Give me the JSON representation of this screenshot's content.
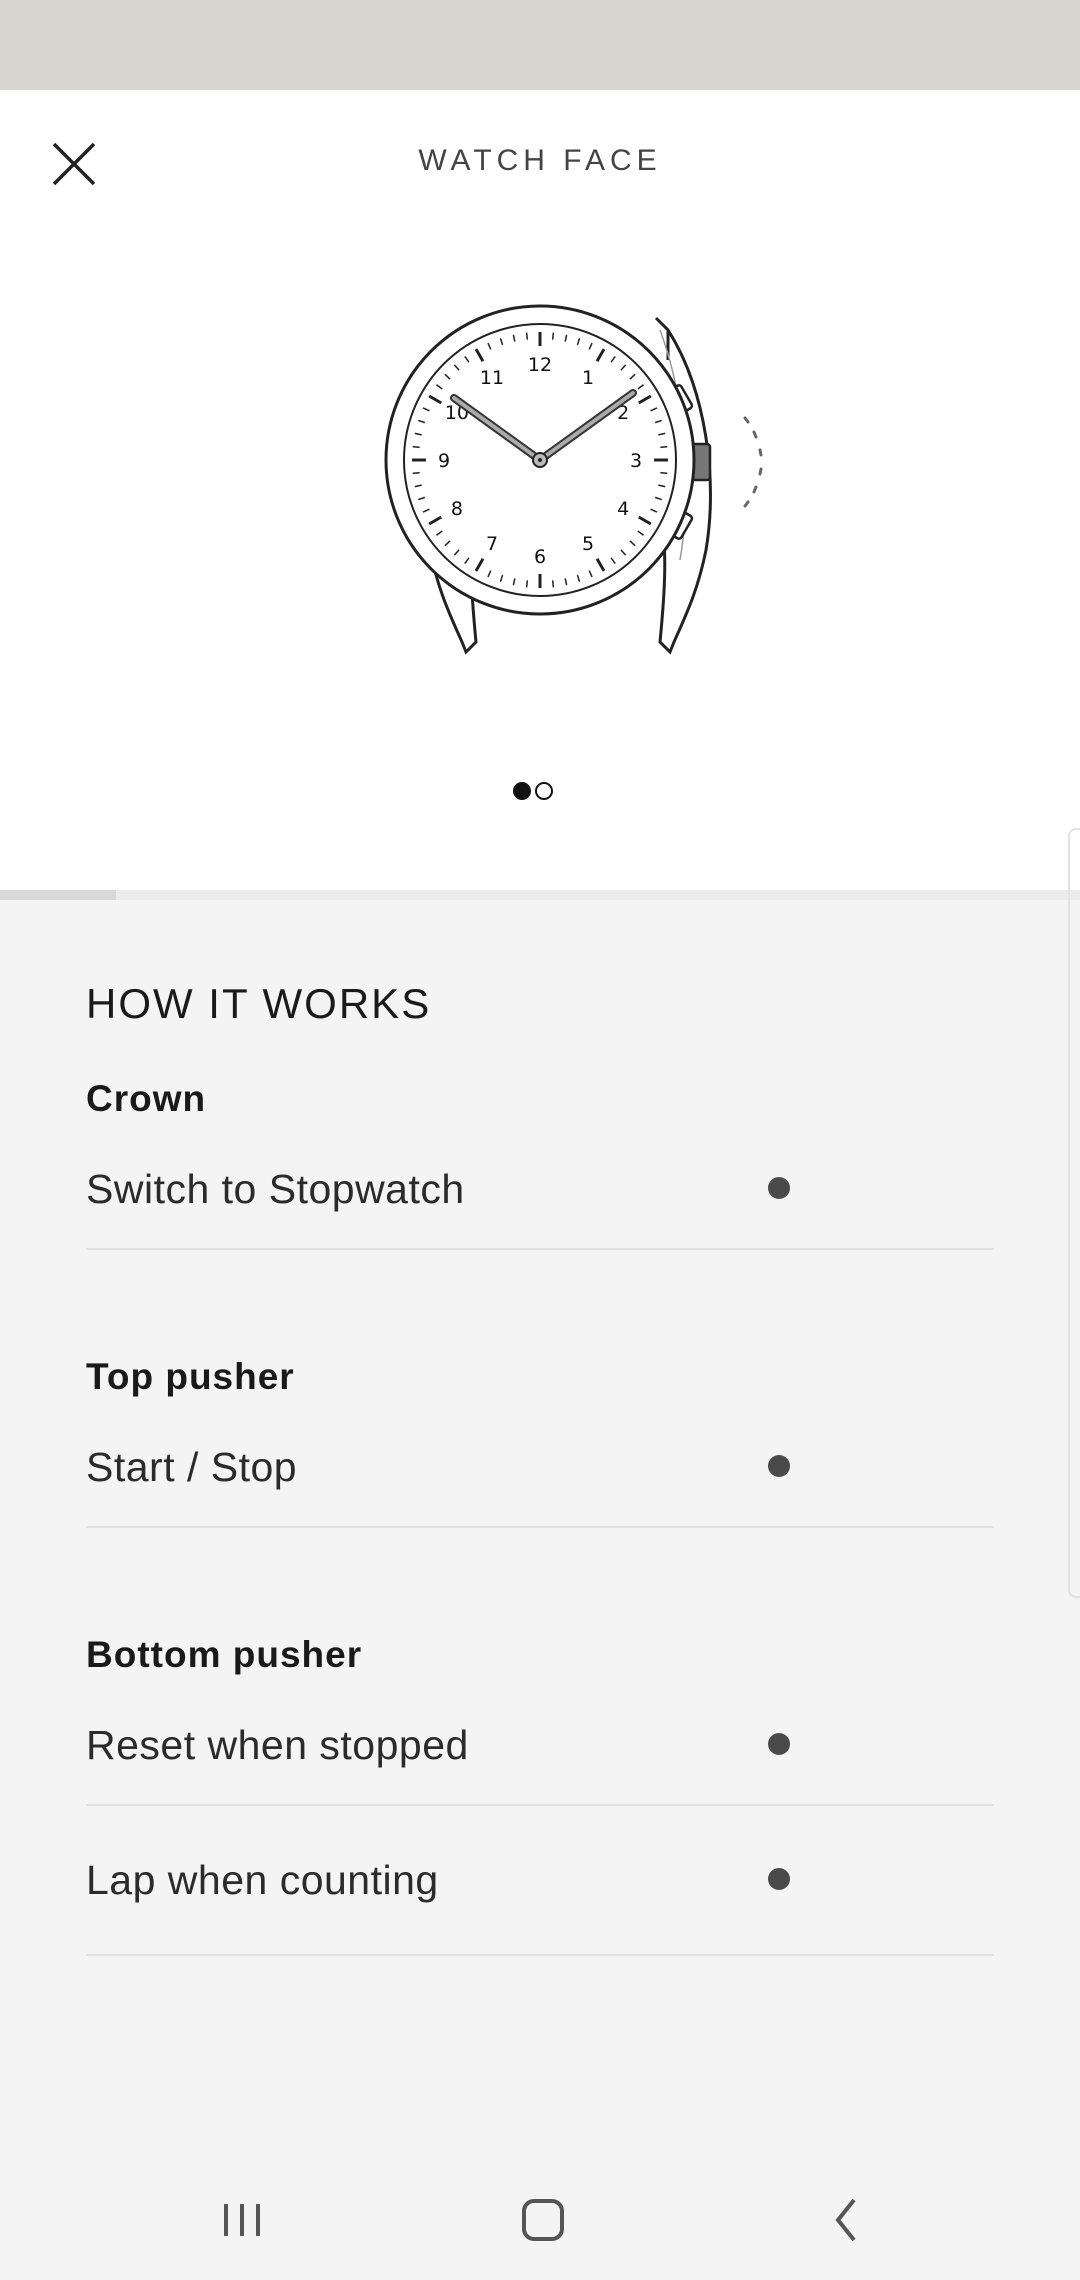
{
  "header": {
    "title": "WATCH FACE"
  },
  "watch": {
    "numerals": [
      "12",
      "1",
      "2",
      "3",
      "4",
      "5",
      "6",
      "7",
      "8",
      "9",
      "10",
      "11"
    ]
  },
  "carousel": {
    "page_count": 2,
    "active_index": 0
  },
  "scroll_progress": 0.107,
  "how_it_works": {
    "title": "HOW IT WORKS",
    "groups": [
      {
        "label": "Crown",
        "items": [
          "Switch to Stopwatch"
        ]
      },
      {
        "label": "Top pusher",
        "items": [
          "Start / Stop"
        ]
      },
      {
        "label": "Bottom pusher",
        "items": [
          "Reset when stopped",
          "Lap when counting"
        ]
      }
    ]
  },
  "navbar": {
    "icons": [
      "recent-apps-icon",
      "home-icon",
      "back-icon"
    ]
  }
}
